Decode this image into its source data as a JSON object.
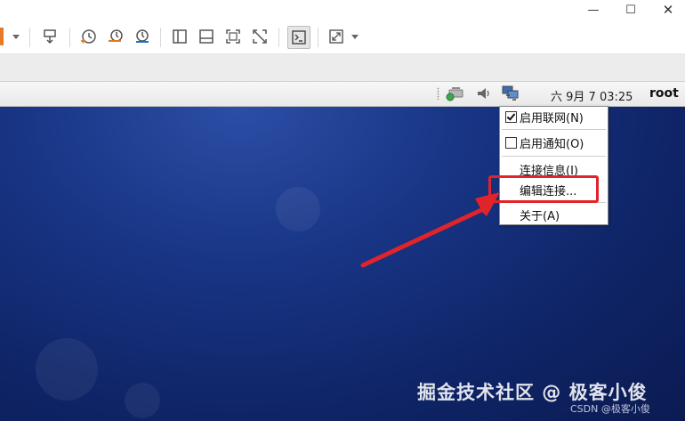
{
  "window": {
    "minimize_glyph": "—",
    "maximize_glyph": "☐",
    "close_glyph": "✕"
  },
  "toolbar": {
    "icons": [
      "power-orange-icon",
      "send-keys-icon",
      "snapshot-icon",
      "restore-snapshot-icon",
      "snapshot-manager-icon",
      "sidebar-icon",
      "thumbnail-icon",
      "fullscreen-icon",
      "unity-icon",
      "console-icon",
      "stretch-icon"
    ]
  },
  "panel": {
    "tray_icons": [
      "network-manager-icon",
      "volume-icon",
      "network-computer-icon"
    ],
    "clock": "六 9月   7 03:25",
    "user": "root"
  },
  "menu": {
    "items": [
      {
        "label": "启用联网(N)",
        "type": "checkbox",
        "checked": true
      },
      {
        "label": "启用通知(O)",
        "type": "checkbox",
        "checked": false
      },
      {
        "label": "连接信息(I)",
        "type": "item"
      },
      {
        "label": "编辑连接...",
        "type": "item",
        "highlighted": true
      },
      {
        "label": "关于(A)",
        "type": "item"
      }
    ]
  },
  "annotation": {
    "color": "#e1232a"
  },
  "watermark": {
    "text": "掘金技术社区 @ 极客小俊",
    "credit": "CSDN @极客小俊"
  }
}
